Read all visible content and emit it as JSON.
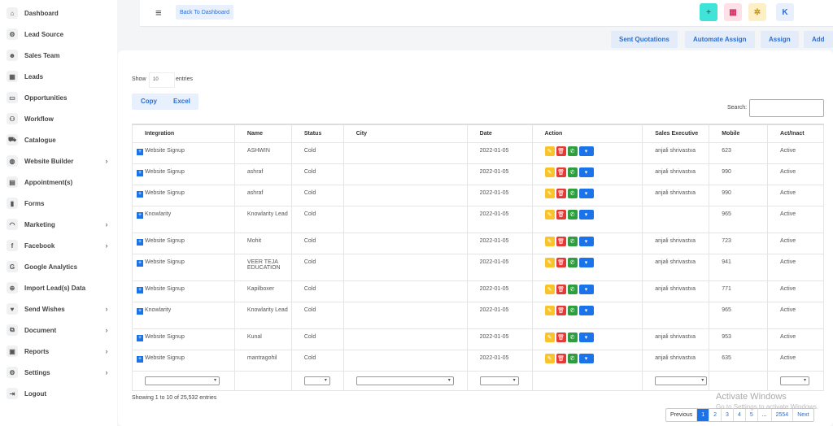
{
  "sidebar": {
    "items": [
      {
        "label": "Dashboard",
        "icon": "⌂",
        "arrow": ""
      },
      {
        "label": "Lead Source",
        "icon": "⚙",
        "arrow": ""
      },
      {
        "label": "Sales Team",
        "icon": "☻",
        "arrow": ""
      },
      {
        "label": "Leads",
        "icon": "▦",
        "arrow": ""
      },
      {
        "label": "Opportunities",
        "icon": "▭",
        "arrow": ""
      },
      {
        "label": "Workflow",
        "icon": "⚇",
        "arrow": ""
      },
      {
        "label": "Catalogue",
        "icon": "⛟",
        "arrow": ""
      },
      {
        "label": "Website Builder",
        "icon": "◍",
        "arrow": "›"
      },
      {
        "label": "Appointment(s)",
        "icon": "▤",
        "arrow": ""
      },
      {
        "label": "Forms",
        "icon": "▮",
        "arrow": ""
      },
      {
        "label": "Marketing",
        "icon": "◠",
        "arrow": "›"
      },
      {
        "label": "Facebook",
        "icon": "f",
        "arrow": "›"
      },
      {
        "label": "Google Analytics",
        "icon": "G",
        "arrow": ""
      },
      {
        "label": "Import Lead(s) Data",
        "icon": "⊕",
        "arrow": ""
      },
      {
        "label": "Send Wishes",
        "icon": "♥",
        "arrow": "›"
      },
      {
        "label": "Document",
        "icon": "⧉",
        "arrow": "›"
      },
      {
        "label": "Reports",
        "icon": "▣",
        "arrow": "›"
      },
      {
        "label": "Settings",
        "icon": "⚙",
        "arrow": "›"
      },
      {
        "label": "Logout",
        "icon": "⇥",
        "arrow": ""
      }
    ]
  },
  "topbar": {
    "back_label": "Back To Dashboard",
    "hamburger_icon": "≡",
    "quick_buttons": [
      {
        "label": "+",
        "bg": "#3fe3d8",
        "color": "#1a7a75"
      },
      {
        "label": "▦",
        "bg": "#fde0e8",
        "color": "#d6336c"
      },
      {
        "label": "✲",
        "bg": "#fdf0c6",
        "color": "#c8900a"
      },
      {
        "label": "K",
        "bg": "#e8f0fe",
        "color": "#2a6fd6"
      }
    ]
  },
  "actions": {
    "sent_quotations": "Sent Quotations",
    "automate_assign": "Automate Assign",
    "assign": "Assign",
    "add": "Add"
  },
  "controls": {
    "show_label": "Show",
    "show_value": "10",
    "entries_label": "entries",
    "copy_label": "Copy",
    "excel_label": "Excel",
    "search_label": "Search:"
  },
  "table": {
    "headers": [
      "Integration",
      "Name",
      "Status",
      "City",
      "Date",
      "Action",
      "Sales Executive",
      "Mobile",
      "Act/Inact"
    ],
    "rows": [
      {
        "integration": "Website Signup",
        "name": "ASHWIN",
        "status": "Cold",
        "city": "",
        "date": "2022-01-05",
        "exec": "anjali shrivastva",
        "mobile": "623",
        "active": "Active"
      },
      {
        "integration": "Website Signup",
        "name": "ashraf",
        "status": "Cold",
        "city": "",
        "date": "2022-01-05",
        "exec": "anjali shrivastva",
        "mobile": "990",
        "active": "Active"
      },
      {
        "integration": "Website Signup",
        "name": "ashraf",
        "status": "Cold",
        "city": "",
        "date": "2022-01-05",
        "exec": "anjali shrivastva",
        "mobile": "990",
        "active": "Active"
      },
      {
        "integration": "Knowlarity",
        "name": "Knowlarity Lead",
        "status": "Cold",
        "city": "",
        "date": "2022-01-05",
        "exec": "",
        "mobile": "965",
        "active": "Active"
      },
      {
        "integration": "Website Signup",
        "name": "Mohit",
        "status": "Cold",
        "city": "",
        "date": "2022-01-05",
        "exec": "anjali shrivastva",
        "mobile": "723",
        "active": "Active"
      },
      {
        "integration": "Website Signup",
        "name": "VEER TEJA EDUCATION",
        "status": "Cold",
        "city": "",
        "date": "2022-01-05",
        "exec": "anjali shrivastva",
        "mobile": "941",
        "active": "Active"
      },
      {
        "integration": "Website Signup",
        "name": "Kapilboxer",
        "status": "Cold",
        "city": "",
        "date": "2022-01-05",
        "exec": "anjali shrivastva",
        "mobile": "771",
        "active": "Active"
      },
      {
        "integration": "Knowlarity",
        "name": "Knowlarity Lead",
        "status": "Cold",
        "city": "",
        "date": "2022-01-05",
        "exec": "",
        "mobile": "965",
        "active": "Active"
      },
      {
        "integration": "Website Signup",
        "name": "Kunal",
        "status": "Cold",
        "city": "",
        "date": "2022-01-05",
        "exec": "anjali shrivastva",
        "mobile": "953",
        "active": "Active"
      },
      {
        "integration": "Website Signup",
        "name": "mantragohil",
        "status": "Cold",
        "city": "",
        "date": "2022-01-05",
        "exec": "anjali shrivastva",
        "mobile": "635",
        "active": "Active"
      }
    ]
  },
  "footer": {
    "showing": "Showing 1 to 10 of 25,532 entries",
    "pages": [
      "Previous",
      "1",
      "2",
      "3",
      "4",
      "5",
      "...",
      "2554",
      "Next"
    ],
    "active_page": "1"
  },
  "watermark": {
    "title": "Activate Windows",
    "subtitle": "Go to Settings to activate Windows."
  }
}
